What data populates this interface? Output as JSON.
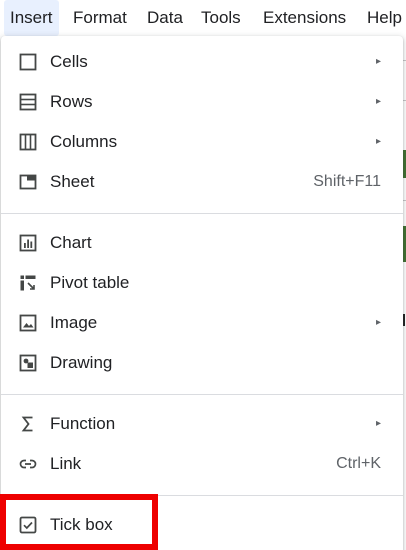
{
  "menubar": {
    "items": [
      {
        "label": "Insert"
      },
      {
        "label": "Format"
      },
      {
        "label": "Data"
      },
      {
        "label": "Tools"
      },
      {
        "label": "Extensions"
      },
      {
        "label": "Help"
      }
    ]
  },
  "menu": {
    "items": [
      {
        "label": "Cells",
        "icon": "cells-icon",
        "submenu": true
      },
      {
        "label": "Rows",
        "icon": "rows-icon",
        "submenu": true
      },
      {
        "label": "Columns",
        "icon": "columns-icon",
        "submenu": true
      },
      {
        "label": "Sheet",
        "icon": "sheet-icon",
        "shortcut": "Shift+F11"
      },
      {
        "label": "Chart",
        "icon": "chart-icon"
      },
      {
        "label": "Pivot table",
        "icon": "pivot-table-icon"
      },
      {
        "label": "Image",
        "icon": "image-icon",
        "submenu": true
      },
      {
        "label": "Drawing",
        "icon": "drawing-icon"
      },
      {
        "label": "Function",
        "icon": "sigma-icon",
        "submenu": true
      },
      {
        "label": "Link",
        "icon": "link-icon",
        "shortcut": "Ctrl+K"
      },
      {
        "label": "Tick box",
        "icon": "checkbox-icon",
        "highlighted": true
      }
    ],
    "submenu_arrow": "▸"
  },
  "colors": {
    "active_menu_bg": "#e8f0fe",
    "highlight_border": "#ee0000",
    "text": "#202124",
    "secondary_text": "#5f6368",
    "separator": "#dadce0"
  }
}
